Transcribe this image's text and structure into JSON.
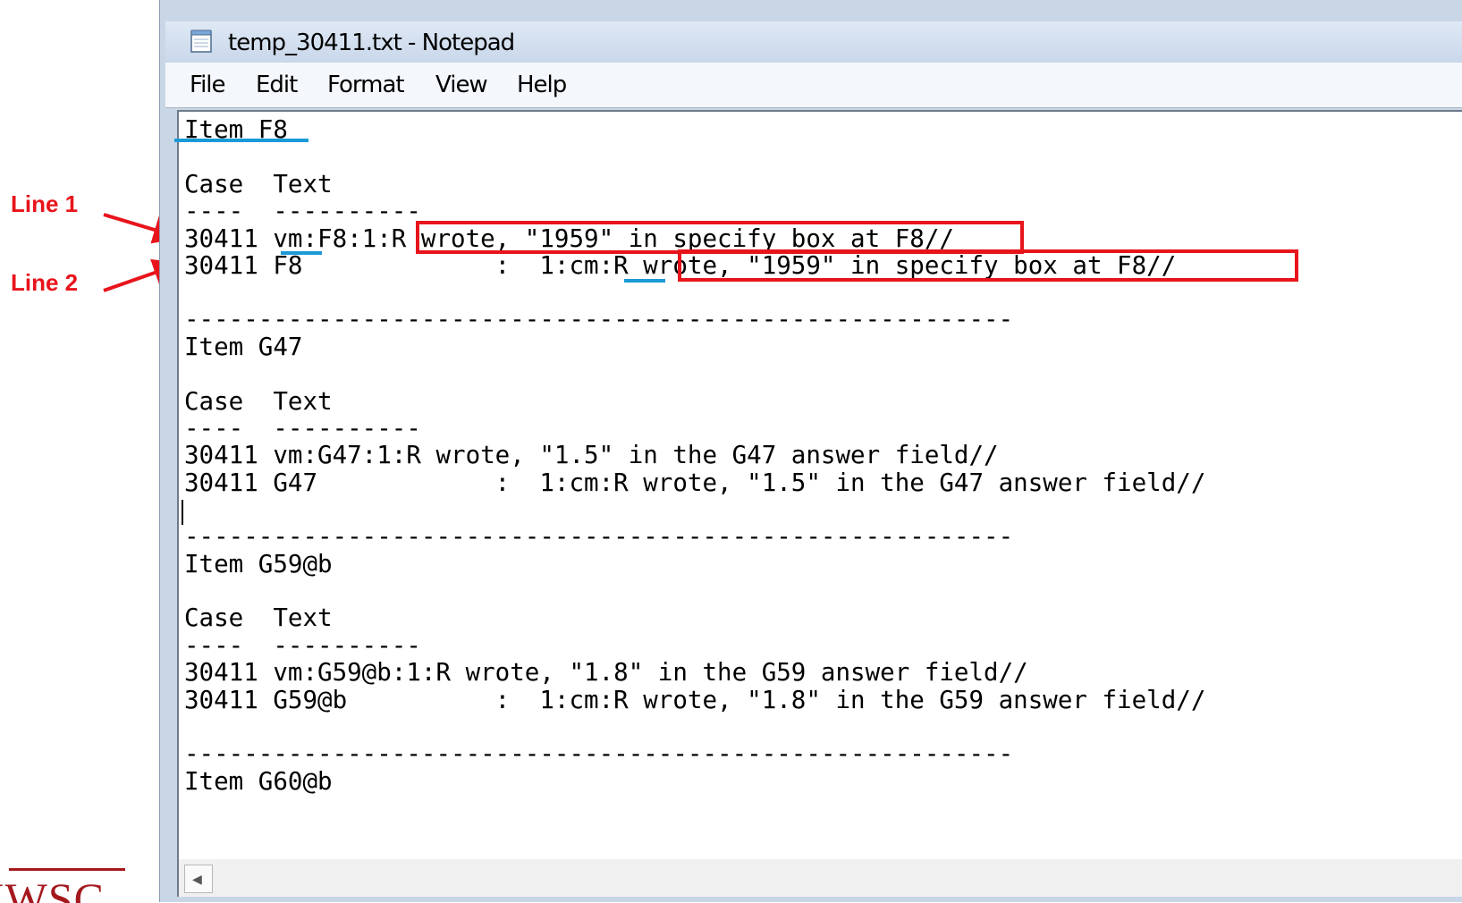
{
  "window": {
    "title": "temp_30411.txt - Notepad"
  },
  "menu": [
    "File",
    "Edit",
    "Format",
    "View",
    "Help"
  ],
  "content_lines": [
    "Item F8",
    "",
    "Case  Text",
    "----  ----------",
    "30411 vm:F8:1:R wrote, \"1959\" in specify box at F8//",
    "30411 F8             :  1:cm:R wrote, \"1959\" in specify box at F8//",
    "",
    "--------------------------------------------------------",
    "Item G47",
    "",
    "Case  Text",
    "----  ----------",
    "30411 vm:G47:1:R wrote, \"1.5\" in the G47 answer field//",
    "30411 G47            :  1:cm:R wrote, \"1.5\" in the G47 answer field//",
    "",
    "--------------------------------------------------------",
    "Item G59@b",
    "",
    "Case  Text",
    "----  ----------",
    "30411 vm:G59@b:1:R wrote, \"1.8\" in the G59 answer field//",
    "30411 G59@b          :  1:cm:R wrote, \"1.8\" in the G59 answer field//",
    "",
    "--------------------------------------------------------",
    "Item G60@b"
  ],
  "annotations": {
    "line1": "Line 1",
    "line2": "Line 2"
  },
  "logo_text": "IWSC",
  "colors": {
    "annotation_red": "#e8141c",
    "underline_blue": "#1a9ad6",
    "logo_red": "#a4191d"
  }
}
